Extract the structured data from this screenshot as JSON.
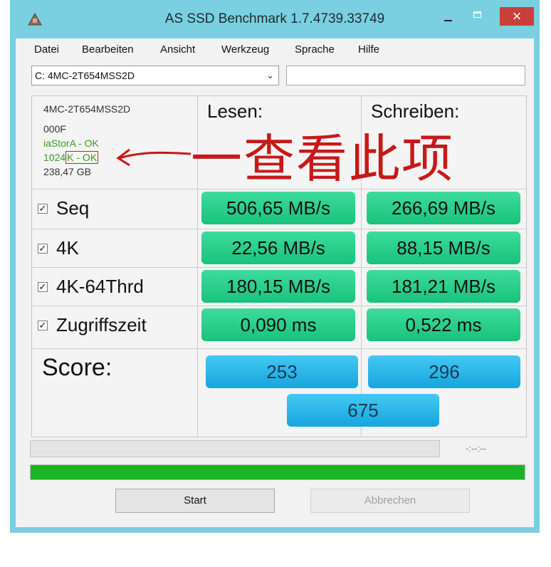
{
  "window": {
    "title": "AS SSD Benchmark 1.7.4739.33749",
    "close_glyph": "×"
  },
  "menu": [
    "Datei",
    "Bearbeiten",
    "Ansicht",
    "Werkzeug",
    "Sprache",
    "Hilfe"
  ],
  "drive_select": {
    "value": "C: 4MC-2T654MSS2D"
  },
  "info": {
    "model": "4MC-2T654MSS2D",
    "firmware": "000F",
    "driver_status": "iaStorA - OK",
    "alignment_prefix": "1024",
    "alignment_status": "K - OK",
    "capacity": "238,47 GB"
  },
  "columns": {
    "read": "Lesen:",
    "write": "Schreiben:"
  },
  "tests": [
    {
      "label": "Seq",
      "checked": true,
      "read": "506,65 MB/s",
      "write": "266,69 MB/s"
    },
    {
      "label": "4K",
      "checked": true,
      "read": "22,56 MB/s",
      "write": "88,15 MB/s"
    },
    {
      "label": "4K-64Thrd",
      "checked": true,
      "read": "180,15 MB/s",
      "write": "181,21 MB/s"
    },
    {
      "label": "Zugriffszeit",
      "checked": true,
      "read": "0,090 ms",
      "write": "0,522 ms"
    }
  ],
  "check_glyph": "✓",
  "score": {
    "label": "Score:",
    "read": "253",
    "write": "296",
    "total": "675"
  },
  "status_readout": "-:--:--",
  "progress": {
    "test_progress": 0,
    "overall_progress": 1.0
  },
  "buttons": {
    "start": "Start",
    "abort": "Abbrechen"
  },
  "annotation": {
    "text": "一查看此项",
    "color": "#c81818"
  },
  "colors": {
    "green_value": "#19c27a",
    "blue_score": "#17a5df",
    "progress_green": "#1bb423",
    "close_red": "#c9403a"
  }
}
